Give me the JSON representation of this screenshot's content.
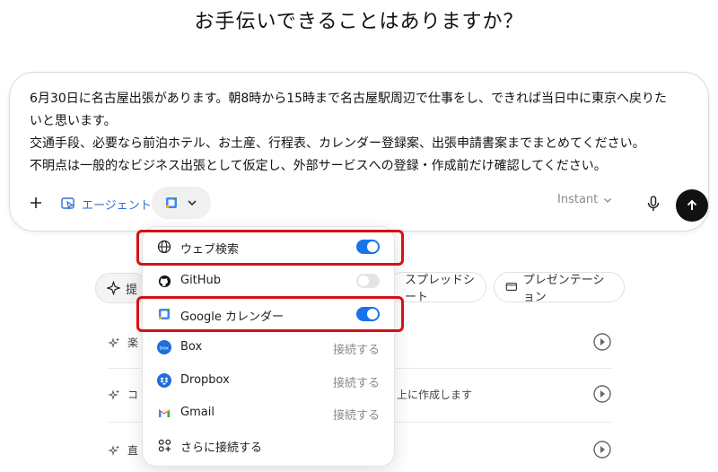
{
  "heading": "お手伝いできることはありますか？",
  "prompt_lines": [
    "6月30日に名古屋出張があります。朝8時から15時まで名古屋駅周辺で仕事をし、できれば当日中に東京へ戻りた",
    "いと思います。",
    "交通手段、必要なら前泊ホテル、お土産、行程表、カレンダー登録案、出張申請書案までまとめてください。",
    "不明点は一般的なビジネス出張として仮定し、外部サービスへの登録・作成前だけ確認してください。"
  ],
  "toolbar": {
    "agent_label": "エージェント",
    "model_label": "Instant",
    "send_label": "↑"
  },
  "chips": {
    "suggest": "提",
    "sheet": "スプレッドシート",
    "presentation": "プレゼンテーション"
  },
  "suggestions": [
    {
      "text": "楽"
    },
    {
      "text": "コ",
      "tail": "上に作成します"
    },
    {
      "text": "直"
    }
  ],
  "dropdown": {
    "items": [
      {
        "label": "ウェブ検索",
        "icon": "globe-icon",
        "state": "on"
      },
      {
        "label": "GitHub",
        "icon": "github-icon",
        "state": "off"
      },
      {
        "label": "Google カレンダー",
        "icon": "google-calendar-icon",
        "state": "on"
      },
      {
        "label": "Box",
        "icon": "box-icon",
        "action": "接続する"
      },
      {
        "label": "Dropbox",
        "icon": "dropbox-icon",
        "action": "接続する"
      },
      {
        "label": "Gmail",
        "icon": "gmail-icon",
        "action": "接続する"
      },
      {
        "label": "さらに接続する",
        "icon": "connect-more-icon"
      }
    ]
  },
  "colors": {
    "accent": "#1a73e8",
    "highlight": "#d80f16",
    "agent": "#2b6fd6"
  }
}
